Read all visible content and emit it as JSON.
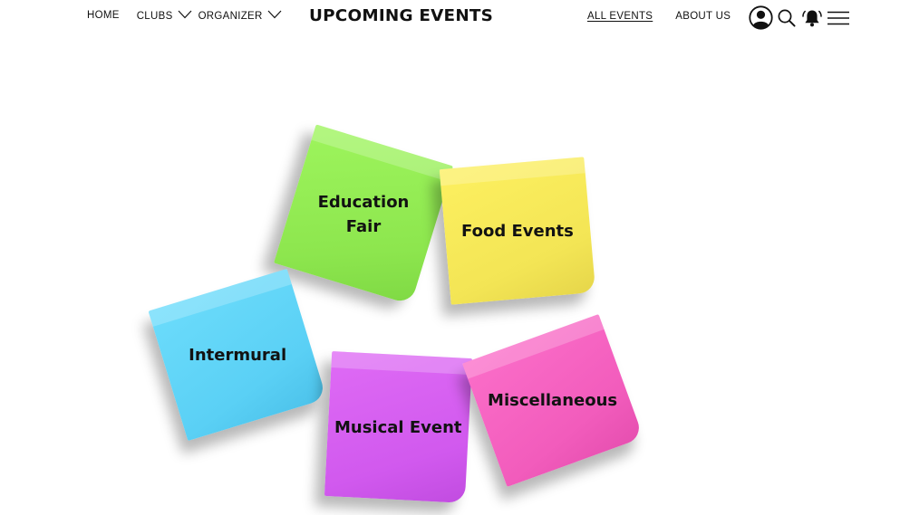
{
  "header": {
    "nav_left": {
      "home": "HOME",
      "clubs": "CLUBS",
      "organizer": "ORGANIZER"
    },
    "title": "UPCOMING EVENTS",
    "nav_right": {
      "all_events": "ALL EVENTS",
      "about_us": "ABOUT US"
    },
    "icons": [
      "user-icon",
      "search-icon",
      "bell-icon",
      "menu-icon"
    ]
  },
  "notes": [
    {
      "label": "Education Fair",
      "color": "#8de64e"
    },
    {
      "label": "Food Events",
      "color": "#f3e555"
    },
    {
      "label": "Intermural",
      "color": "#5ad0f5"
    },
    {
      "label": "Musical Event",
      "color": "#d159ee"
    },
    {
      "label": "Miscellaneous",
      "color": "#f25cbc"
    }
  ]
}
